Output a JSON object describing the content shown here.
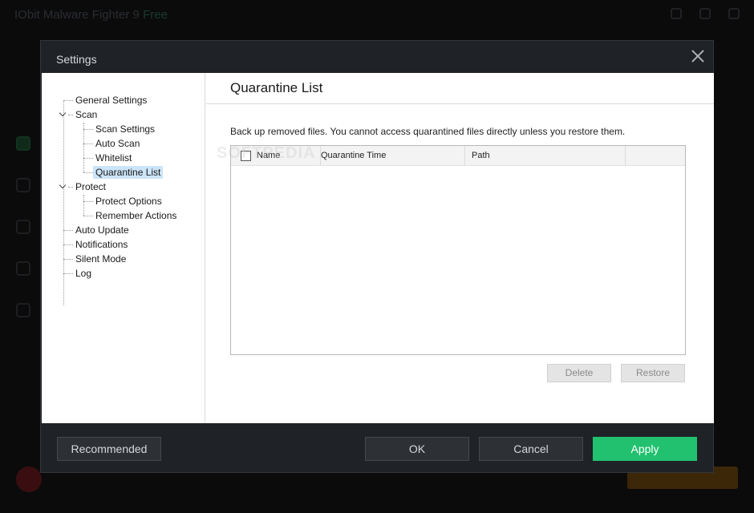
{
  "background": {
    "app_title": "IObit Malware Fighter 9",
    "app_badge": "Free"
  },
  "dialog": {
    "title": "Settings",
    "tree": [
      {
        "label": "General Settings"
      },
      {
        "label": "Scan"
      },
      {
        "label": "Scan Settings"
      },
      {
        "label": "Auto Scan"
      },
      {
        "label": "Whitelist"
      },
      {
        "label": "Quarantine List",
        "selected": true
      },
      {
        "label": "Protect"
      },
      {
        "label": "Protect Options"
      },
      {
        "label": "Remember Actions"
      },
      {
        "label": "Auto Update"
      },
      {
        "label": "Notifications"
      },
      {
        "label": "Silent Mode"
      },
      {
        "label": "Log"
      }
    ],
    "main": {
      "title": "Quarantine List",
      "description": "Back up removed files. You cannot access quarantined files directly unless you restore them.",
      "columns": [
        "Name",
        "Quarantine Time",
        "Path"
      ],
      "rows": [],
      "delete_label": "Delete",
      "restore_label": "Restore"
    },
    "footer": {
      "recommended_label": "Recommended",
      "ok_label": "OK",
      "cancel_label": "Cancel",
      "apply_label": "Apply"
    },
    "watermark": "SOFTPEDIA"
  },
  "colors": {
    "dialog_bg": "#1f2226",
    "apply_green": "#21c16f",
    "selection": "#cce4f7"
  }
}
